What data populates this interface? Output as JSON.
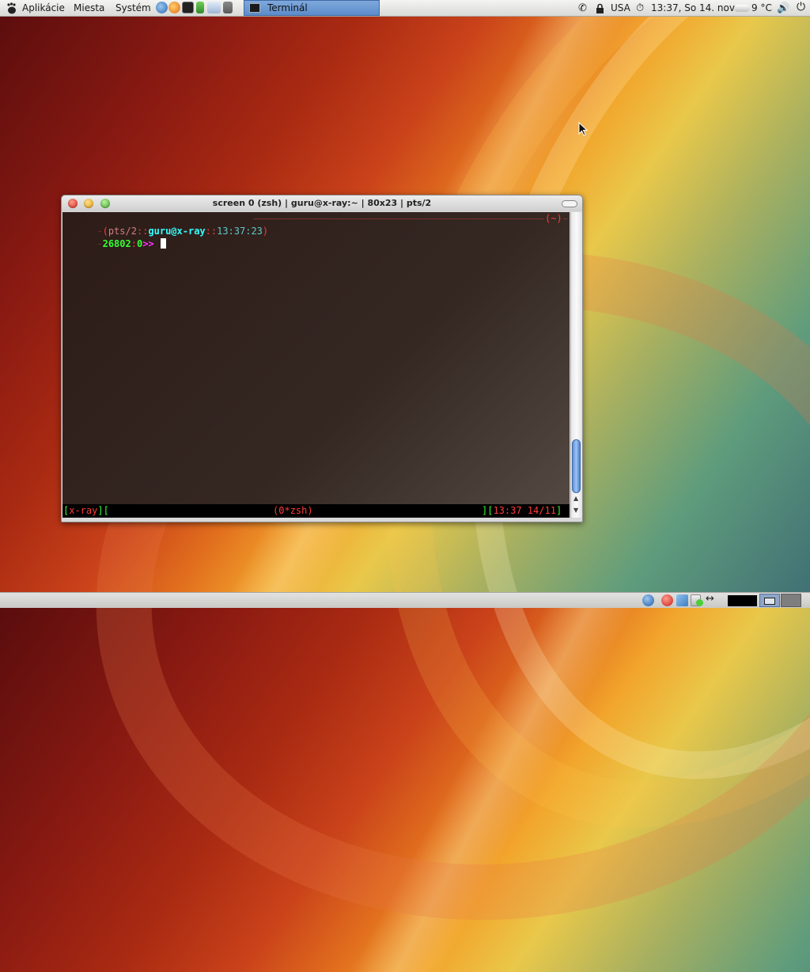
{
  "top_panel": {
    "menus": {
      "applications": "Aplikácie",
      "places": "Miesta",
      "system": "Systém"
    },
    "launchers": [
      "web-browser-icon",
      "firefox-icon",
      "terminal-icon",
      "system-monitor-icon",
      "file-manager-icon",
      "trash-icon"
    ],
    "task": {
      "label": "Terminál",
      "icon": "terminal-icon"
    },
    "tray": {
      "keyboard_layout": "USA",
      "clock": "13:37, So 14. nov",
      "weather": "9 °C"
    }
  },
  "terminal_window": {
    "title": "screen 0 (zsh) | guru@x-ray:~ | 80x23 | pts/2",
    "prompt_line1": {
      "open": "(",
      "tty": "pts/2",
      "sep1": "::",
      "user_host": "guru@x-ray",
      "sep2": "::",
      "time": "13:37:23",
      "close": ")",
      "cwd": "(~)"
    },
    "prompt_line2": {
      "pid": "26802",
      "sep": ":",
      "status": "0",
      "arrows": ">>"
    },
    "statusbar": {
      "host": "[x-ray][",
      "window": "(0*zsh)",
      "right_bracket": "][",
      "datetime": "13:37 14/11",
      "end": "]"
    }
  },
  "colors": {
    "prompt_red": "#ff3b3b",
    "prompt_dim": "#b07070",
    "cyan": "#33ffff",
    "green": "#33ff33",
    "magenta": "#ff33ff",
    "cyan_dim": "#5fc9c9"
  }
}
